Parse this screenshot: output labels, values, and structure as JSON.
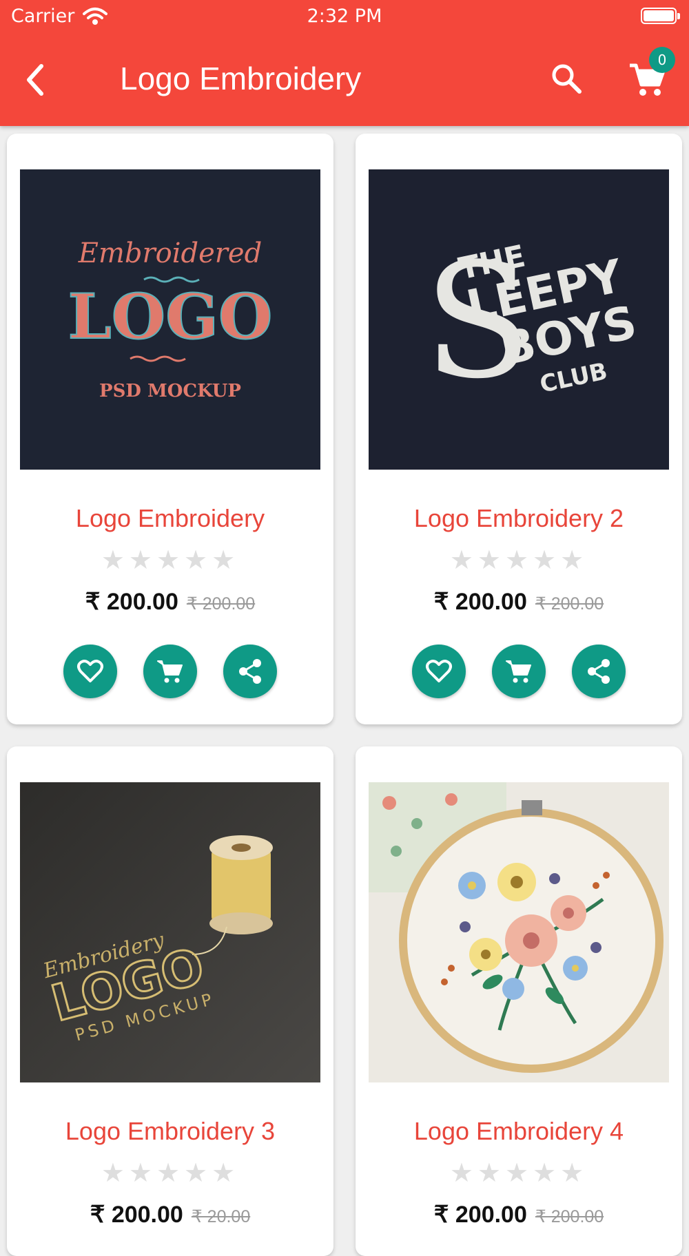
{
  "status": {
    "carrier": "Carrier",
    "time": "2:32 PM"
  },
  "header": {
    "title": "Logo Embroidery",
    "cart_count": "0"
  },
  "products": [
    {
      "name": "Logo Embroidery",
      "price": "₹ 200.00",
      "old_price": "₹ 200.00",
      "stars": "★★★★★"
    },
    {
      "name": "Logo Embroidery 2",
      "price": "₹ 200.00",
      "old_price": "₹ 200.00",
      "stars": "★★★★★"
    },
    {
      "name": "Logo Embroidery 3",
      "price": "₹ 200.00",
      "old_price": "₹ 20.00",
      "stars": "★★★★★"
    },
    {
      "name": "Logo Embroidery 4",
      "price": "₹ 200.00",
      "old_price": "₹ 200.00",
      "stars": "★★★★★"
    }
  ],
  "images": {
    "p1": {
      "script": "Embroidered",
      "main": "LOGO",
      "sub": "PSD MOCKUP"
    },
    "p2": {
      "l1": "THE",
      "l2": "LEEPY",
      "l3": "BOYS",
      "l4": "CLUB",
      "big": "S"
    },
    "p3": {
      "script": "Embroidery",
      "main": "LOGO",
      "sub": "PSD MOCKUP"
    }
  },
  "colors": {
    "primary": "#f4473b",
    "accent": "#0f9a86"
  },
  "icons": [
    "back-icon",
    "search-icon",
    "cart-icon",
    "heart-icon",
    "add-cart-icon",
    "share-icon",
    "star-icon"
  ]
}
